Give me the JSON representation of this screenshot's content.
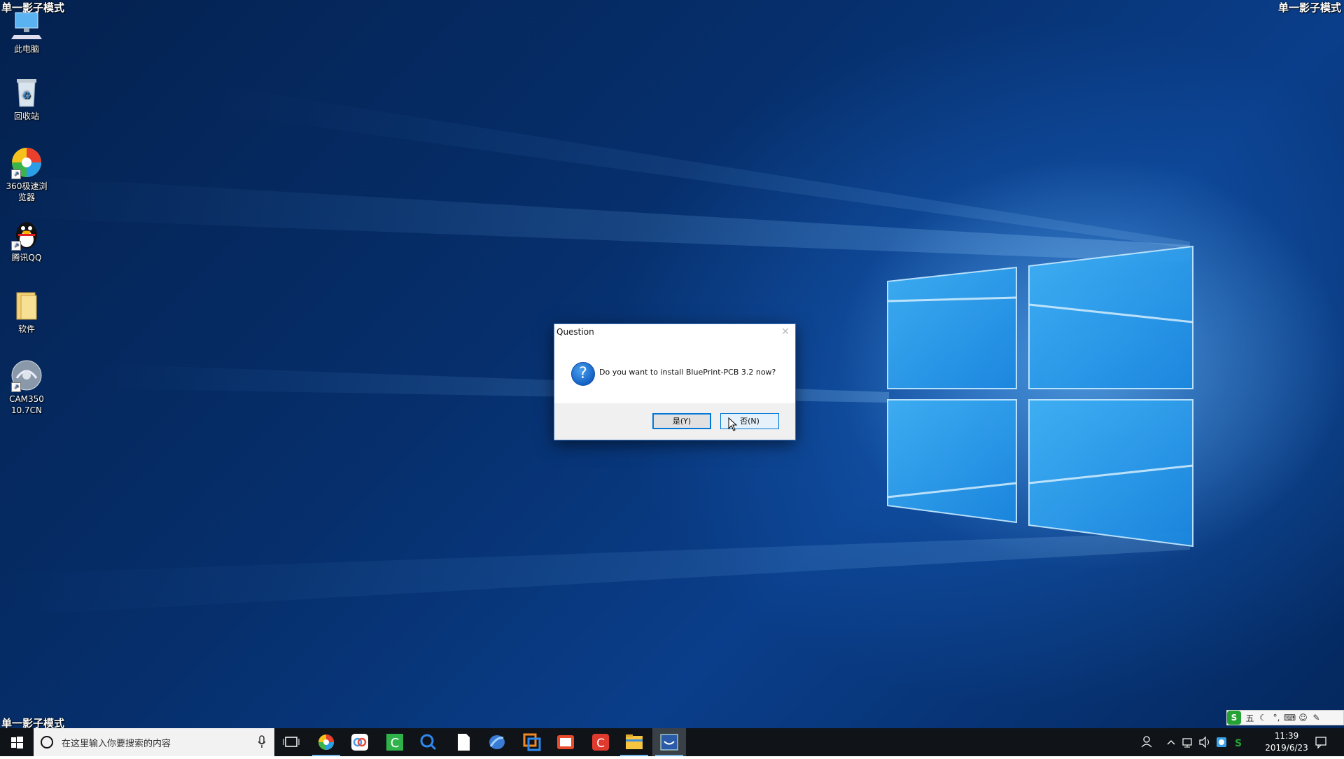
{
  "watermark": {
    "top_left": "单一影子模式",
    "top_right": "单一影子模式",
    "bottom_left": "单一影子模式"
  },
  "desktop_icons": [
    {
      "label": "此电脑",
      "icon": "this-pc-icon"
    },
    {
      "label": "回收站",
      "icon": "recycle-bin-icon"
    },
    {
      "label": "360极速浏览器",
      "icon": "360-browser-icon"
    },
    {
      "label": "腾讯QQ",
      "icon": "qq-icon"
    },
    {
      "label": "软件",
      "icon": "folder-icon"
    },
    {
      "label": "CAM350 10.7CN",
      "icon": "cam350-icon"
    }
  ],
  "dialog": {
    "title": "Question",
    "message": "Do you want to install BluePrint-PCB 3.2 now?",
    "yes_label": "是(Y)",
    "no_label": "否(N)",
    "icon": "question-icon"
  },
  "ime_bar": {
    "items": [
      "S",
      "五",
      "☾",
      "°,",
      "⌨",
      "☺",
      "✎"
    ]
  },
  "taskbar": {
    "search_placeholder": "在这里输入你要搜索的内容",
    "apps": [
      {
        "name": "task-view",
        "color": "#ffffff"
      },
      {
        "name": "360-browser",
        "color": "#e84b3c"
      },
      {
        "name": "baidu-netdisk",
        "color": "#4a9ff0"
      },
      {
        "name": "camtasia",
        "color": "#2fb24a"
      },
      {
        "name": "search-tool",
        "color": "#2d89ef"
      },
      {
        "name": "blank-document",
        "color": "#ffffff"
      },
      {
        "name": "app-blue",
        "color": "#3a7bd5"
      },
      {
        "name": "app-orange",
        "color": "#f08a24"
      },
      {
        "name": "app-red-orange",
        "color": "#e84b2c"
      },
      {
        "name": "app-red",
        "color": "#e03a2e"
      },
      {
        "name": "file-explorer",
        "color": "#f5c542"
      },
      {
        "name": "installer",
        "color": "#2a5aa8"
      }
    ],
    "time": "11:39",
    "date": "2019/6/23"
  },
  "colors": {
    "accent": "#0078d7",
    "taskbar": "#101418",
    "desktop": "#062f6c"
  }
}
